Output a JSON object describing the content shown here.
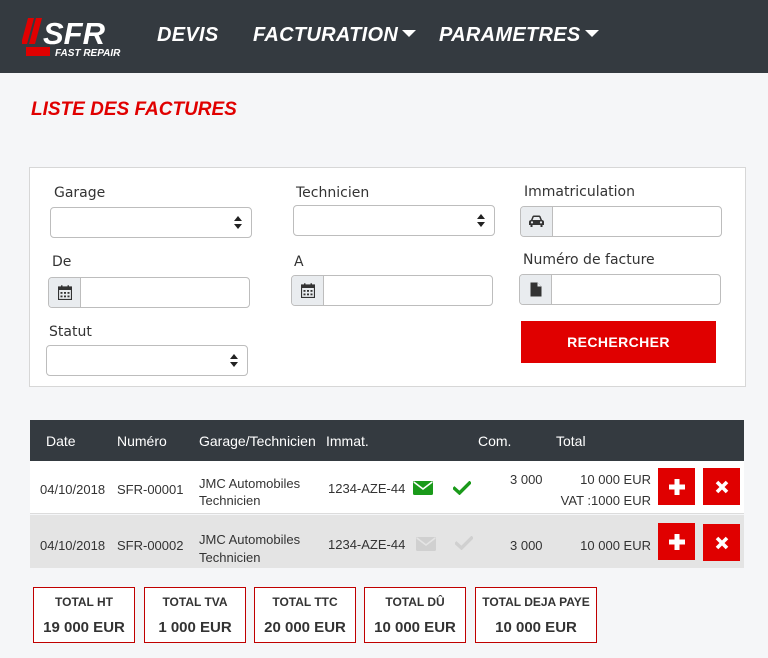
{
  "brand": {
    "logo_main": "SFR",
    "logo_sub": "FAST REPAIR"
  },
  "nav": {
    "devis": "DEVIS",
    "facturation": "FACTURATION",
    "parametres": "PARAMETRES"
  },
  "page_title": "LISTE DES FACTURES",
  "filters": {
    "garage_label": "Garage",
    "technicien_label": "Technicien",
    "immatriculation_label": "Immatriculation",
    "de_label": "De",
    "a_label": "A",
    "numero_label": "Numéro de facture",
    "statut_label": "Statut",
    "search_button": "RECHERCHER"
  },
  "table": {
    "headers": [
      "Date",
      "Numéro",
      "Garage/Technicien",
      "Immat.",
      "Com.",
      "Total"
    ],
    "rows": [
      {
        "date": "04/10/2018",
        "numero": "SFR-00001",
        "garage": "JMC Automobiles",
        "technicien": "Technicien",
        "immat": "1234-AZE-44",
        "com": "3 000",
        "total": "10 000 EUR",
        "vat": "VAT :1000 EUR",
        "mail_sent": true,
        "validated": true
      },
      {
        "date": "04/10/2018",
        "numero": "SFR-00002",
        "garage": "JMC Automobiles",
        "technicien": "Technicien",
        "immat": "1234-AZE-44",
        "com": "3 000",
        "total": "10 000 EUR",
        "vat": "",
        "mail_sent": false,
        "validated": false
      }
    ]
  },
  "totals": [
    {
      "label": "TOTAL HT",
      "value": "19 000 EUR"
    },
    {
      "label": "TOTAL TVA",
      "value": "1 000 EUR"
    },
    {
      "label": "TOTAL TTC",
      "value": "20 000 EUR"
    },
    {
      "label": "TOTAL DÛ",
      "value": "10 000 EUR"
    },
    {
      "label": "TOTAL DEJA PAYE",
      "value": "10 000 EUR"
    }
  ],
  "colors": {
    "accent": "#e00000",
    "navbar": "#343a40",
    "success": "#1a9a1a"
  },
  "icons": [
    "car-icon",
    "calendar-icon",
    "file-icon",
    "envelope-icon",
    "check-icon",
    "plus-icon",
    "close-icon"
  ]
}
